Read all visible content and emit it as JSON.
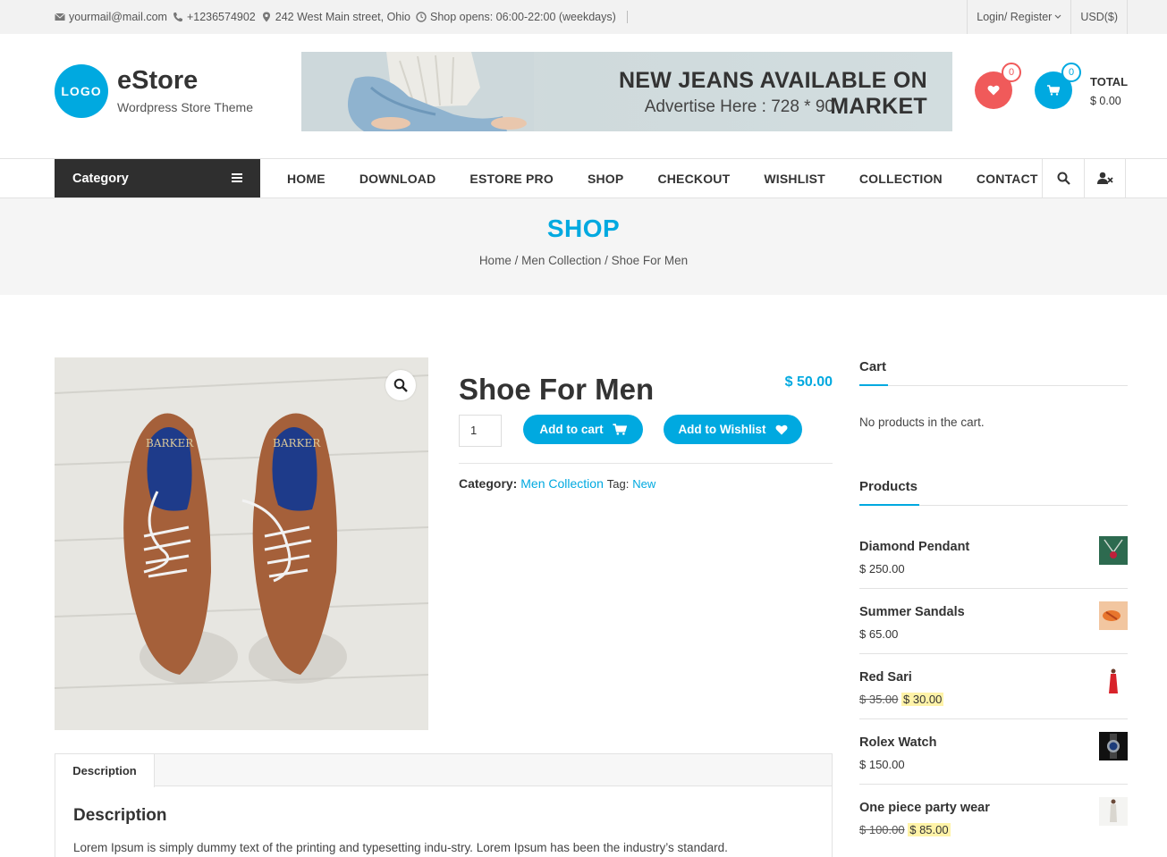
{
  "topbar": {
    "email": "yourmail@mail.com",
    "phone": "+1236574902",
    "address": "242 West Main street, Ohio",
    "hours": "Shop opens: 06:00-22:00 (weekdays)",
    "login": "Login/ Register",
    "currency": "USD($)"
  },
  "header": {
    "logo": "LOGO",
    "title": "eStore",
    "tagline": "Wordpress Store Theme",
    "banner_title": "NEW JEANS AVAILABLE ON MARKET",
    "banner_sub": "Advertise Here : 728 * 90",
    "wishlist_count": "0",
    "cart_count": "0",
    "total_label": "TOTAL",
    "total_value": "$ 0.00"
  },
  "nav": {
    "category": "Category",
    "items": [
      "HOME",
      "DOWNLOAD",
      "ESTORE PRO",
      "SHOP",
      "CHECKOUT",
      "WISHLIST",
      "COLLECTION",
      "CONTACT"
    ]
  },
  "page": {
    "title": "SHOP",
    "breadcrumb": "Home / Men Collection / Shoe For Men"
  },
  "product": {
    "name": "Shoe For Men",
    "price": "$ 50.00",
    "qty": "1",
    "add_to_cart": "Add to cart",
    "add_to_wishlist": "Add to Wishlist",
    "category_label": "Category:",
    "category_value": "Men Collection",
    "tag_label": "Tag:",
    "tag_value": "New"
  },
  "tabs": {
    "active": "Description",
    "heading": "Description",
    "text": "Lorem Ipsum is simply dummy text of the printing and typesetting indu-stry. Lorem Ipsum has been the industry’s standard."
  },
  "sidebar": {
    "cart_title": "Cart",
    "cart_empty": "No products in the cart.",
    "products_title": "Products",
    "products": [
      {
        "name": "Diamond Pendant",
        "price": "$ 250.00",
        "old": "",
        "thumb": "pendant"
      },
      {
        "name": "Summer Sandals",
        "price": "$ 65.00",
        "old": "",
        "thumb": "sandals"
      },
      {
        "name": "Red Sari",
        "price": "$ 30.00",
        "old": "$ 35.00",
        "thumb": "sari"
      },
      {
        "name": "Rolex Watch",
        "price": "$ 150.00",
        "old": "",
        "thumb": "watch"
      },
      {
        "name": "One piece party wear",
        "price": "$ 85.00",
        "old": "$ 100.00",
        "thumb": "dress"
      }
    ]
  },
  "colors": {
    "accent": "#00a9e0",
    "wish": "#f05a5a",
    "dark": "#2f2f2f"
  }
}
